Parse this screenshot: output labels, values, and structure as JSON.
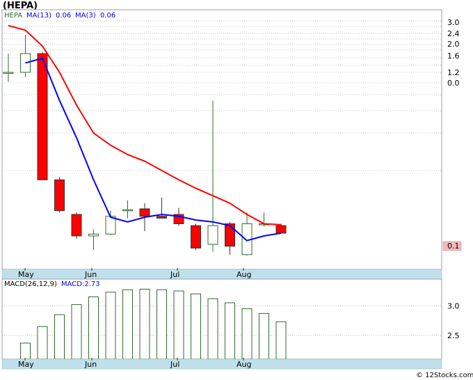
{
  "header": {
    "ticker": "(HEPA)"
  },
  "legend": {
    "symbol": "HEPA",
    "ma13_label": "MA(13)",
    "ma13_value": "0.06",
    "ma3_label": "MA(3)",
    "ma3_value": "0.06"
  },
  "macd_legend": {
    "label": "MACD(26,12,9)",
    "value_label": "MACD:2.73"
  },
  "footer": {
    "credit": "© 12Stocks.com"
  },
  "colors": {
    "up_candle": "#2e6b2e",
    "down_candle": "#ff0000",
    "ma13": "#ff0000",
    "ma3": "#0000ff",
    "macd_bar": "#2e6b2e",
    "month_strip": "#bfe0ea",
    "last_price_box": "#f4b8b8"
  },
  "chart_data": [
    {
      "type": "candlestick",
      "title": "(HEPA)",
      "y_tick_labels": [
        "3.0",
        "2.4",
        "2.0",
        "1.6",
        "1.2",
        "0.0"
      ],
      "last_price_label": "0.1",
      "x_month_labels": [
        "May",
        "Jun",
        "Jul",
        "Aug"
      ],
      "candles": [
        {
          "o": 2.5,
          "h": 2.7,
          "l": 2.4,
          "c": 2.5
        },
        {
          "o": 2.5,
          "h": 2.9,
          "l": 2.45,
          "c": 2.7
        },
        {
          "o": 2.7,
          "h": 2.72,
          "l": 1.35,
          "c": 1.35
        },
        {
          "o": 1.35,
          "h": 1.38,
          "l": 1.0,
          "c": 1.02
        },
        {
          "o": 0.98,
          "h": 1.0,
          "l": 0.72,
          "c": 0.75
        },
        {
          "o": 0.75,
          "h": 0.82,
          "l": 0.6,
          "c": 0.77
        },
        {
          "o": 0.77,
          "h": 1.02,
          "l": 0.76,
          "c": 0.96
        },
        {
          "o": 1.03,
          "h": 1.13,
          "l": 0.94,
          "c": 1.03
        },
        {
          "o": 1.04,
          "h": 1.1,
          "l": 0.8,
          "c": 0.96
        },
        {
          "o": 0.96,
          "h": 1.16,
          "l": 0.95,
          "c": 0.94
        },
        {
          "o": 0.98,
          "h": 1.05,
          "l": 0.86,
          "c": 0.88
        },
        {
          "o": 0.86,
          "h": 0.88,
          "l": 0.6,
          "c": 0.62
        },
        {
          "o": 0.66,
          "h": 2.2,
          "l": 0.58,
          "c": 0.86
        },
        {
          "o": 0.88,
          "h": 0.9,
          "l": 0.55,
          "c": 0.64
        },
        {
          "o": 0.55,
          "h": 1.0,
          "l": 0.54,
          "c": 0.88
        },
        {
          "o": 0.88,
          "h": 1.0,
          "l": 0.85,
          "c": 0.88
        },
        {
          "o": 0.86,
          "h": 0.88,
          "l": 0.78,
          "c": 0.78
        }
      ],
      "ma13": [
        3.0,
        2.95,
        2.78,
        2.5,
        2.15,
        1.85,
        1.72,
        1.62,
        1.55,
        1.45,
        1.35,
        1.26,
        1.18,
        1.1,
        0.98,
        0.88,
        0.87
      ],
      "ma3": [
        null,
        2.6,
        2.65,
        2.2,
        1.8,
        1.35,
        0.95,
        0.9,
        0.95,
        0.98,
        0.96,
        0.92,
        0.9,
        0.86,
        0.7,
        0.75,
        0.78
      ]
    },
    {
      "type": "bar",
      "title": "MACD(26,12,9)",
      "y_tick_labels": [
        "3.0",
        "2.5"
      ],
      "x_month_labels": [
        "May",
        "Jun",
        "Jul",
        "Aug"
      ],
      "values": [
        2.37,
        2.65,
        2.85,
        3.02,
        3.15,
        3.23,
        3.27,
        3.28,
        3.27,
        3.25,
        3.2,
        3.12,
        3.05,
        2.95,
        2.87,
        2.73
      ]
    }
  ]
}
